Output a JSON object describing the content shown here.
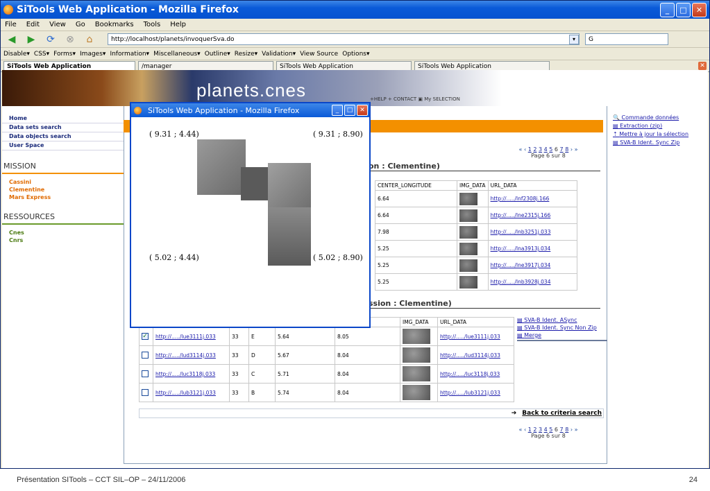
{
  "window": {
    "title": "SiTools Web Application - Mozilla Firefox"
  },
  "menu": [
    "File",
    "Edit",
    "View",
    "Go",
    "Bookmarks",
    "Tools",
    "Help"
  ],
  "nav": {
    "url": "http://localhost/planets/invoquerSva.do",
    "search_value": "G"
  },
  "devbar": [
    "Disable▾",
    "CSS▾",
    "Forms▾",
    "Images▾",
    "Information▾",
    "Miscellaneous▾",
    "Outline▾",
    "Resize▾",
    "Validation▾",
    "View Source",
    "Options▾"
  ],
  "tabs": [
    "SiTools Web Application",
    "/manager",
    "SiTools Web Application",
    "SiTools Web Application"
  ],
  "site": {
    "banner_title": "planets.cnes",
    "top_links": "+HELP  + CONTACT  ▣ My SELECTION",
    "nav_links": [
      "Home",
      "Data sets search",
      "Data objects search",
      "User Space"
    ],
    "mission_heading": "MISSION",
    "missions": [
      "Cassini",
      "Clementine",
      "Mars Express"
    ],
    "resources_heading": "RESSOURCES",
    "resources": [
      "Cnes",
      "Cnrs"
    ]
  },
  "pager": {
    "prefix": "«   ‹",
    "pages": [
      "1",
      "2",
      "3",
      "4",
      "5",
      "6",
      "7",
      "8"
    ],
    "suffix": "›  »",
    "label": "Page 6 sur 8"
  },
  "section1": {
    "title": "on : Clementine)"
  },
  "section2": {
    "title": "ssion : Clementine)"
  },
  "table1": {
    "headers": [
      "CENTER_LONGITUDE",
      "IMG_DATA",
      "URL_DATA"
    ],
    "rows": [
      {
        "lon": "6.64",
        "url": "http://...../lnf2308j.166"
      },
      {
        "lon": "6.64",
        "url": "http://...../lne2315j.166"
      },
      {
        "lon": "7.98",
        "url": "http://...../lnb3251j.033"
      },
      {
        "lon": "5.25",
        "url": "http://...../lna3913j.034"
      },
      {
        "lon": "5.25",
        "url": "http://...../lne3917j.034"
      },
      {
        "lon": "5.25",
        "url": "http://...../lnb3928j.034"
      }
    ]
  },
  "table2": {
    "headers": [
      "ONGITUDE",
      "IMG_DATA",
      "URL_DATA"
    ],
    "rows": [
      {
        "checked": true,
        "url": "http://...../lue3111j.033",
        "orbit": "33",
        "code": "E",
        "lat": "5.64",
        "lon": "8.05",
        "url2": "http://...../lue3111j.033"
      },
      {
        "checked": false,
        "url": "http://...../lud3114j.033",
        "orbit": "33",
        "code": "D",
        "lat": "5.67",
        "lon": "8.04",
        "url2": "http://...../lud3114j.033"
      },
      {
        "checked": false,
        "url": "http://...../luc3118j.033",
        "orbit": "33",
        "code": "C",
        "lat": "5.71",
        "lon": "8.04",
        "url2": "http://...../luc3118j.033"
      },
      {
        "checked": false,
        "url": "http://...../lub3121j.033",
        "orbit": "33",
        "code": "B",
        "lat": "5.74",
        "lon": "8.04",
        "url2": "http://...../lub3121j.033"
      }
    ]
  },
  "right_links": [
    "Commande données",
    "Extraction (zip)",
    "Mettre à jour la sélection",
    "SVA-B Ident. Sync Zip"
  ],
  "actions": [
    "SVA-B Ident. ASync",
    "SVA-B Ident. Sync Non Zip",
    "Merge"
  ],
  "back_link": "Back to criteria search",
  "popup": {
    "title": "SiTools Web Application - Mozilla Firefox",
    "top_left": "( 9.31 ; 4.44)",
    "top_right": "( 9.31 ; 8.90)",
    "bottom_left": "( 5.02 ; 4.44)",
    "bottom_right": "( 5.02 ; 8.90)"
  },
  "footer": {
    "left": "Présentation SITools – CCT SIL–OP – 24/11/2006",
    "right": "24"
  }
}
